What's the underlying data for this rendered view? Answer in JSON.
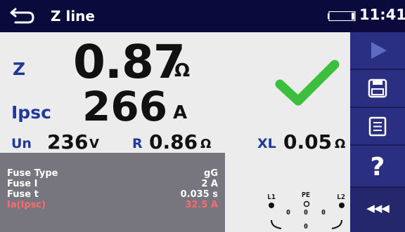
{
  "header": {
    "title": "Z line",
    "clock": "11:41",
    "back_icon": "back-arrow-icon",
    "battery_icon": "battery-icon"
  },
  "results": {
    "z": {
      "label": "Z",
      "value": "0.87",
      "unit": "Ω"
    },
    "ipsc": {
      "label": "Ipsc",
      "value": "266",
      "unit": "A"
    },
    "status_icon": "pass-checkmark-icon"
  },
  "subresults": {
    "un": {
      "label": "Un",
      "value": "236",
      "unit": "V"
    },
    "r": {
      "label": "R",
      "value": "0.86",
      "unit": "Ω"
    },
    "xl": {
      "label": "XL",
      "value": "0.05",
      "unit": "Ω"
    }
  },
  "fuse": {
    "rows": [
      {
        "key": "Fuse Type",
        "value": "gG",
        "color": "white"
      },
      {
        "key": "Fuse I",
        "value": "2 A",
        "color": "white"
      },
      {
        "key": "Fuse t",
        "value": "0.035 s",
        "color": "white"
      },
      {
        "key": "Ia(Ipsc)",
        "value": "32.5 A",
        "color": "red"
      }
    ]
  },
  "connection": {
    "terminals": [
      "L1",
      "PE",
      "L2"
    ],
    "pair_values": [
      "0",
      "0",
      "0"
    ],
    "bottom_value": "0"
  },
  "toolbar": {
    "buttons": [
      {
        "icon": "run-play-icon"
      },
      {
        "icon": "save-floppy-icon"
      },
      {
        "icon": "list-document-icon"
      },
      {
        "icon": "help-question-icon",
        "glyph": "?"
      },
      {
        "icon": "more-icon",
        "glyph": "◀◀◀"
      }
    ]
  },
  "colors": {
    "header_bg": "#0a0b3c",
    "sidebar_bg": "#27286a",
    "label_blue": "#1f3a9a",
    "pass_green": "#3cbf3c",
    "alert_red": "#ff6b6b",
    "panel_gray": "#77767f"
  }
}
